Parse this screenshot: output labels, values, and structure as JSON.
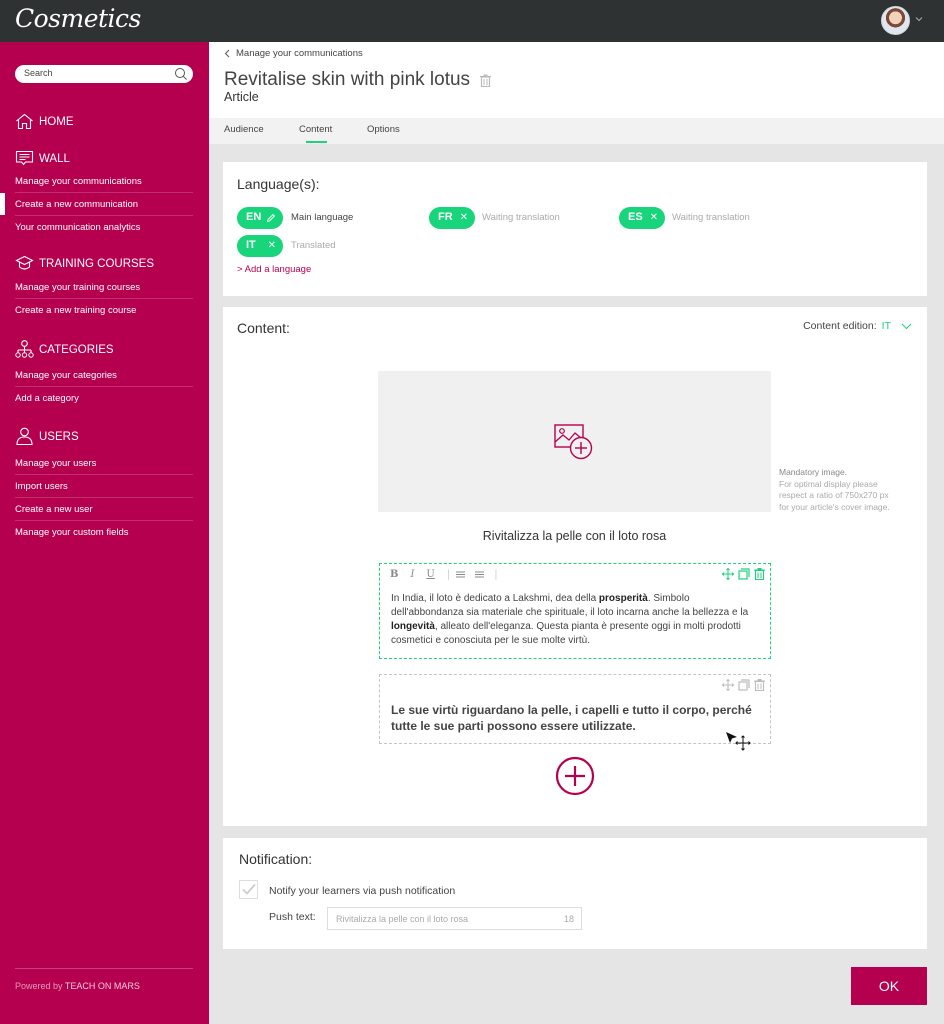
{
  "app": {
    "title": "Cosmetics"
  },
  "user_menu": {
    "icon": "avatar",
    "chevron": "chevron-down-icon"
  },
  "sidebar": {
    "search": {
      "placeholder": "Search"
    },
    "sections": [
      {
        "label": "HOME",
        "icon": "home-icon",
        "items": []
      },
      {
        "label": "WALL",
        "icon": "wall-icon",
        "items": [
          "Manage your communications",
          "Create a new communication",
          "Your communication analytics"
        ]
      },
      {
        "label": "TRAINING COURSES",
        "icon": "graduation-cap-icon",
        "items": [
          "Manage your training courses",
          "Create a new training course"
        ]
      },
      {
        "label": "CATEGORIES",
        "icon": "hierarchy-icon",
        "items": [
          "Manage your categories",
          "Add a category"
        ]
      },
      {
        "label": "USERS",
        "icon": "user-icon",
        "items": [
          "Manage your users",
          "Import users",
          "Create a new user",
          "Manage your custom fields"
        ]
      }
    ],
    "active_item": "Create a new communication",
    "footer_prefix": "Powered by ",
    "footer_brand": "TEACH ON MARS"
  },
  "header": {
    "breadcrumb": "Manage your communications",
    "title": "Revitalise skin with pink lotus",
    "subtitle": "Article"
  },
  "tabs": [
    {
      "label": "Audience",
      "active": false
    },
    {
      "label": "Content",
      "active": true
    },
    {
      "label": "Options",
      "active": false
    }
  ],
  "languages": {
    "title": "Language(s):",
    "chips": [
      {
        "code": "EN",
        "action": "edit",
        "status": "Main language"
      },
      {
        "code": "FR",
        "action": "remove",
        "status": "Waiting translation"
      },
      {
        "code": "ES",
        "action": "remove",
        "status": "Waiting translation"
      },
      {
        "code": "IT",
        "action": "remove",
        "status": "Translated"
      }
    ],
    "add_label": "Add a language"
  },
  "content": {
    "title": "Content:",
    "edition_label": "Content edition:",
    "edition_lang": "IT",
    "cover_note_title": "Mandatory image.",
    "cover_note_lines": [
      "For optimal display please",
      "respect a ratio of 750x270 px",
      "for your article's cover image."
    ],
    "article_title": "Rivitalizza la pelle con il loto rosa",
    "toolbar": [
      "B",
      "I",
      "U",
      "bulleted-list",
      "numbered-list"
    ],
    "block1": {
      "t1": "In India, il loto è dedicato a Lakshmi, dea della ",
      "b1": "prosperità",
      "t2": ". Simbolo dell'abbondanza sia materiale che spirituale, il loto incarna anche la bellezza e la ",
      "b2": "longevità",
      "t3": ", alleato dell'eleganza. Questa pianta è presente oggi in molti prodotti cosmetici e conosciuta per le sue molte virtù."
    },
    "block2": "Le sue virtù riguardano la pelle, i capelli e tutto il corpo, perché tutte le sue parti possono essere utilizzate."
  },
  "notification": {
    "title": "Notification:",
    "checkbox_label": "Notify your learners via push notification",
    "checked": true,
    "push_label": "Push text:",
    "push_placeholder": "Rivitalizza la pelle con il loto rosa",
    "push_count": "18"
  },
  "ok_label": "OK",
  "colors": {
    "brand": "#b5004f",
    "accent": "#18d47b",
    "topbar": "#2e3233"
  }
}
